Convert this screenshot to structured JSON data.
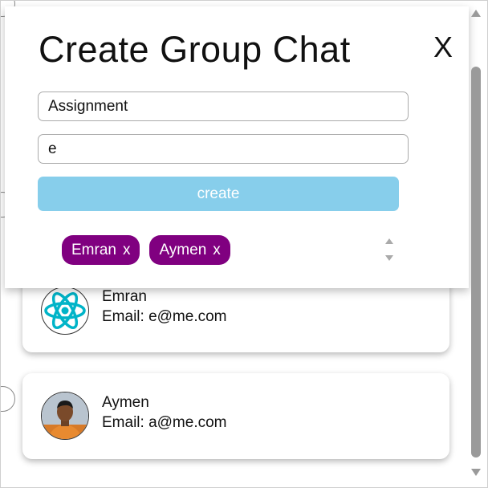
{
  "modal": {
    "title": "Create Group Chat",
    "close_label": "X",
    "chat_name_value": "Assignment",
    "search_value": "e",
    "create_label": "create",
    "selected_users": [
      {
        "name": "Emran",
        "remove": "x"
      },
      {
        "name": "Aymen",
        "remove": "x"
      }
    ]
  },
  "results": [
    {
      "name": "Emran",
      "email": "Email: e@me.com",
      "avatar": "react-logo-icon"
    },
    {
      "name": "Aymen",
      "email": "Email: a@me.com",
      "avatar": "user-photo"
    }
  ],
  "colors": {
    "create_button": "#87ceeb",
    "chip": "#800080",
    "react_logo": "#00b4c8"
  }
}
